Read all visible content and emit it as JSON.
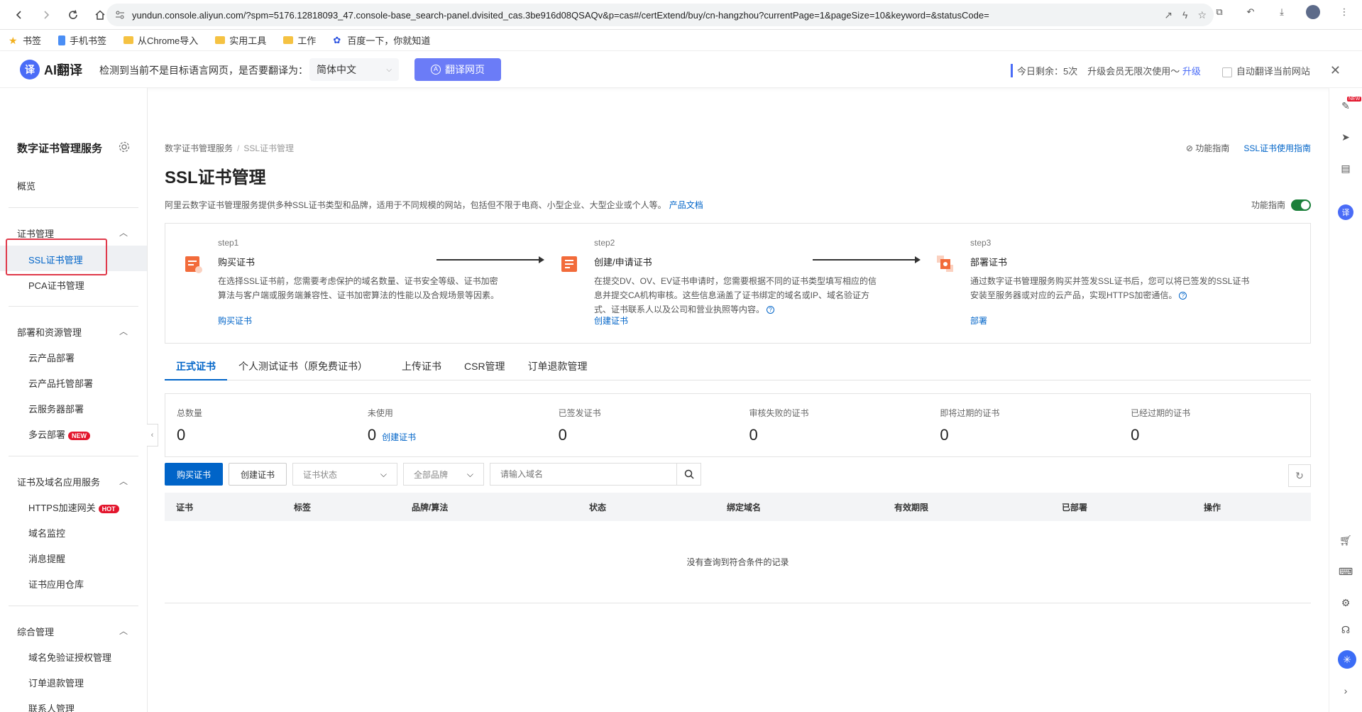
{
  "browser": {
    "url": "yundun.console.aliyun.com/?spm=5176.12818093_47.console-base_search-panel.dvisited_cas.3be916d08QSAQv&p=cas#/certExtend/buy/cn-hangzhou?currentPage=1&pageSize=10&keyword=&statusCode=",
    "bookmarks": [
      "书签",
      "手机书签",
      "从Chrome导入",
      "实用工具",
      "工作",
      "百度一下，你就知道"
    ]
  },
  "translate_bar": {
    "logo": "AI翻译",
    "logo_badge": "译",
    "question": "检测到当前不是目标语言网页，是否要翻译为：",
    "language": "简体中文",
    "translate_button": "翻译网页",
    "quota": "今日剩余：5次",
    "upgrade_text": "升级会员无限次使用～",
    "upgrade_link": "升级",
    "auto_translate": "自动翻译当前网站"
  },
  "sidebar": {
    "title": "数字证书管理服务",
    "overview": "概览",
    "groups": [
      {
        "label": "证书管理",
        "items": [
          "SSL证书管理",
          "PCA证书管理"
        ]
      },
      {
        "label": "部署和资源管理",
        "items": [
          "云产品部署",
          "云产品托管部署",
          "云服务器部署",
          "多云部署"
        ]
      },
      {
        "label": "证书及域名应用服务",
        "items": [
          "HTTPS加速网关",
          "域名监控",
          "消息提醒",
          "证书应用仓库"
        ]
      },
      {
        "label": "综合管理",
        "items": [
          "域名免验证授权管理",
          "订单退款管理",
          "联系人管理"
        ]
      }
    ],
    "badge_new": "NEW",
    "badge_hot": "HOT"
  },
  "main": {
    "breadcrumb": [
      "数字证书管理服务",
      "SSL证书管理"
    ],
    "guide_link": "功能指南",
    "doc_link": "SSL证书使用指南",
    "title": "SSL证书管理",
    "description": "阿里云数字证书管理服务提供多种SSL证书类型和品牌，适用于不同规模的网站，包括但不限于电商、小型企业、大型企业或个人等。",
    "description_link": "产品文档",
    "fn_guide_label": "功能指南",
    "steps": [
      {
        "step": "step1",
        "name": "购买证书",
        "text": "在选择SSL证书前，您需要考虑保护的域名数量、证书安全等级、证书加密算法与客户端或服务端兼容性、证书加密算法的性能以及合规场景等因素。",
        "link": "购买证书"
      },
      {
        "step": "step2",
        "name": "创建/申请证书",
        "text": "在提交DV、OV、EV证书申请时，您需要根据不同的证书类型填写相应的信息并提交CA机构审核。这些信息涵盖了证书绑定的域名或IP、域名验证方式、证书联系人以及公司和营业执照等内容。",
        "link": "创建证书"
      },
      {
        "step": "step3",
        "name": "部署证书",
        "text": "通过数字证书管理服务购买并签发SSL证书后，您可以将已签发的SSL证书安装至服务器或对应的云产品，实现HTTPS加密通信。",
        "link": "部署"
      }
    ],
    "tabs": [
      "正式证书",
      "个人测试证书（原免费证书）",
      "上传证书",
      "CSR管理",
      "订单退款管理"
    ],
    "stats": [
      {
        "label": "总数量",
        "value": "0"
      },
      {
        "label": "未使用",
        "value": "0",
        "link": "创建证书"
      },
      {
        "label": "已签发证书",
        "value": "0"
      },
      {
        "label": "审核失败的证书",
        "value": "0"
      },
      {
        "label": "即将过期的证书",
        "value": "0"
      },
      {
        "label": "已经过期的证书",
        "value": "0"
      }
    ],
    "toolbar": {
      "buy": "购买证书",
      "create": "创建证书",
      "status_select": "证书状态",
      "brand_select": "全部品牌",
      "search_placeholder": "请输入域名"
    },
    "table": {
      "columns": [
        "证书",
        "标签",
        "品牌/算法",
        "状态",
        "绑定域名",
        "有效期限",
        "已部署",
        "操作"
      ],
      "empty": "没有查询到符合条件的记录"
    }
  },
  "rail": {
    "badge_new": "NEW",
    "translate_badge": "译"
  }
}
